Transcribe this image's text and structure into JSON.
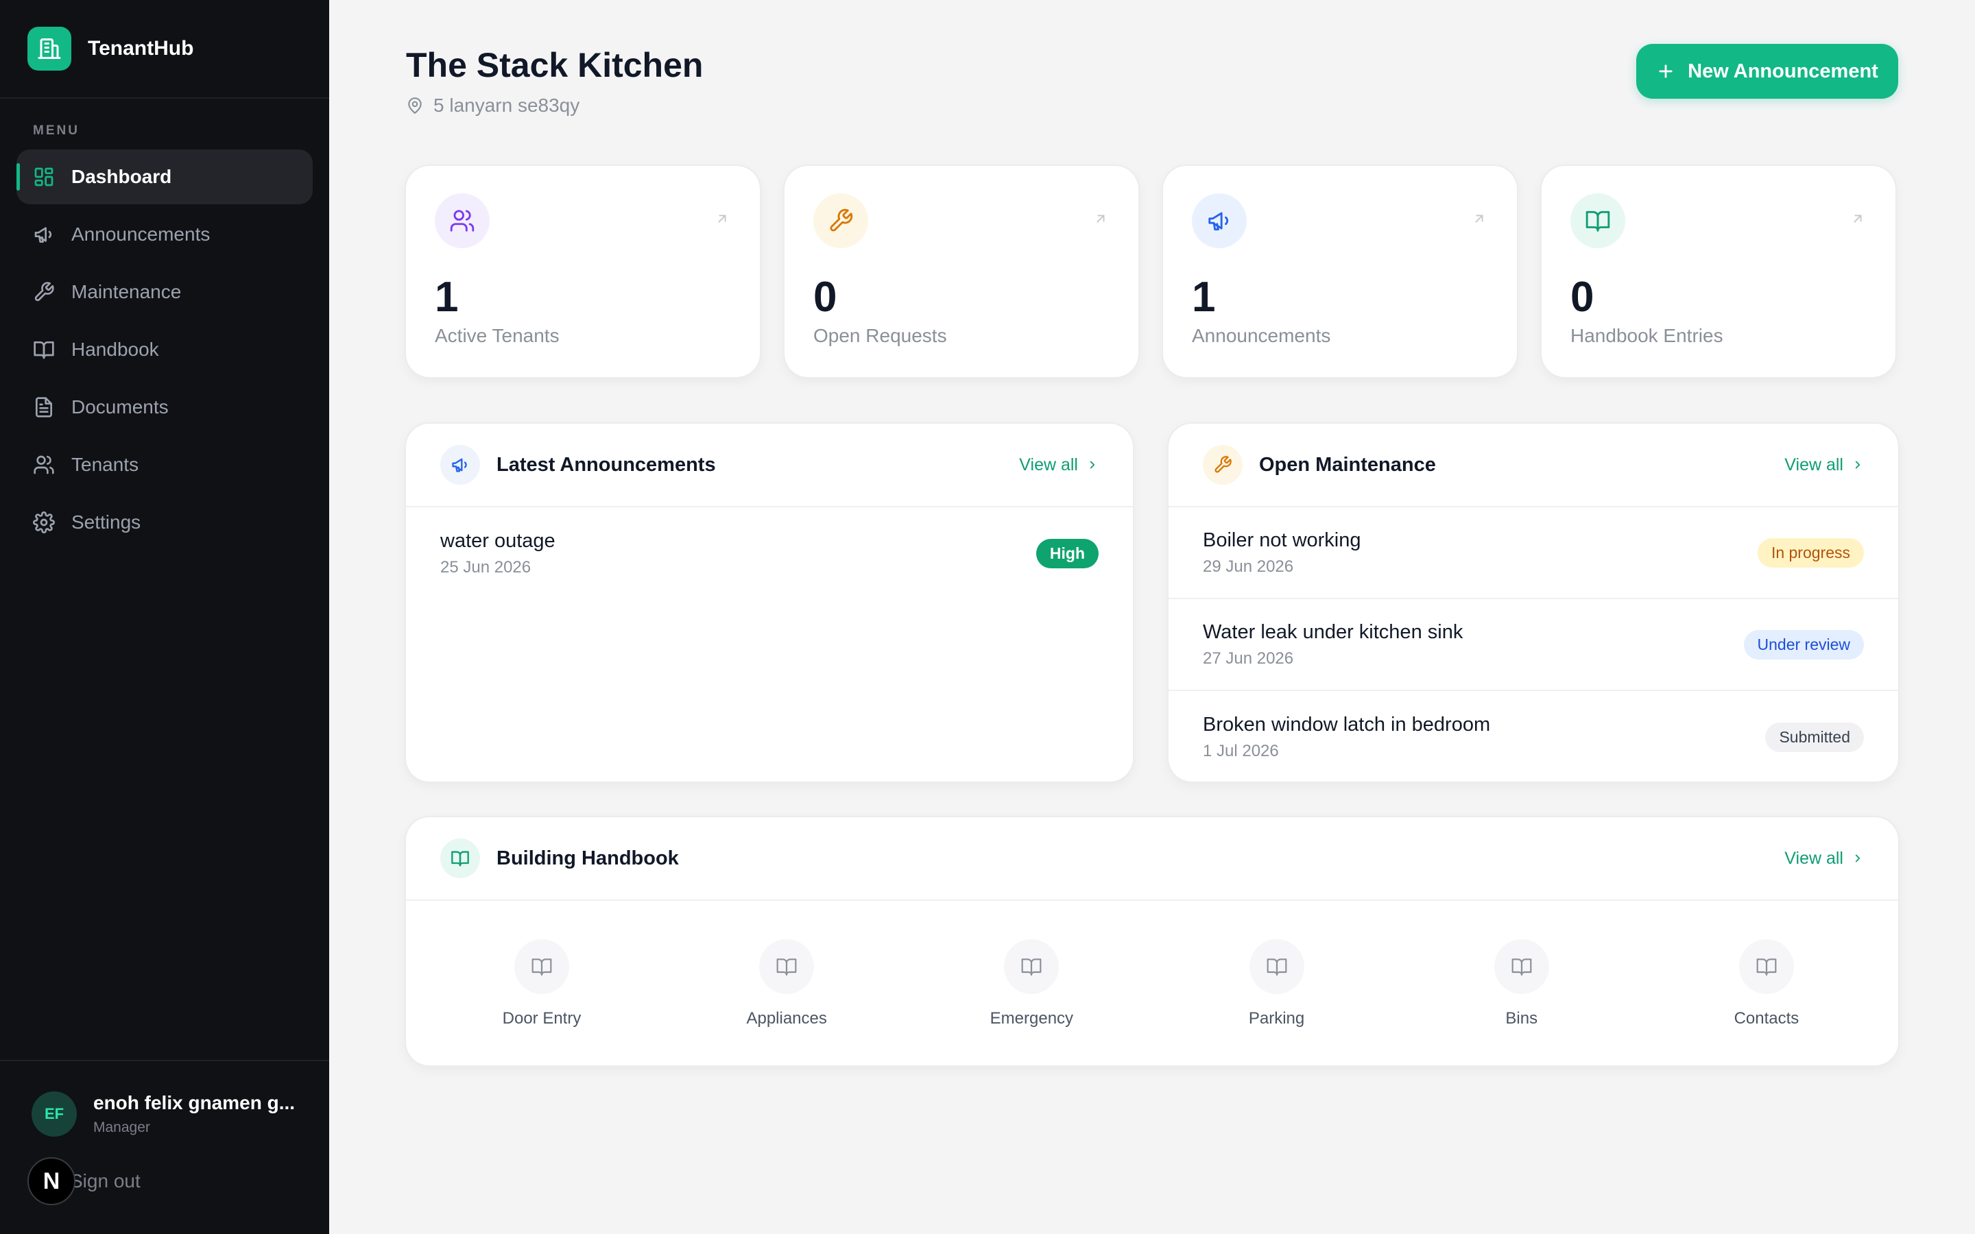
{
  "app": {
    "name": "TenantHub"
  },
  "sidebar": {
    "caption": "MENU",
    "items": [
      {
        "label": "Dashboard",
        "icon": "dashboard-icon",
        "active": true
      },
      {
        "label": "Announcements",
        "icon": "megaphone-icon"
      },
      {
        "label": "Maintenance",
        "icon": "wrench-icon"
      },
      {
        "label": "Handbook",
        "icon": "book-icon"
      },
      {
        "label": "Documents",
        "icon": "document-icon"
      },
      {
        "label": "Tenants",
        "icon": "users-icon"
      },
      {
        "label": "Settings",
        "icon": "gear-icon"
      }
    ],
    "user": {
      "initials": "EF",
      "name": "enoh felix gnamen g...",
      "role": "Manager"
    },
    "signout_label": "Sign out",
    "dev_badge": "N"
  },
  "header": {
    "title": "The Stack Kitchen",
    "address": "5 lanyarn se83qy",
    "new_button_label": "New Announcement"
  },
  "stats": [
    {
      "value": "1",
      "label": "Active Tenants",
      "icon": "users-icon",
      "color": "#7c3aed"
    },
    {
      "value": "0",
      "label": "Open Requests",
      "icon": "wrench-icon",
      "color": "#d97706"
    },
    {
      "value": "1",
      "label": "Announcements",
      "icon": "megaphone-icon",
      "color": "#2563eb"
    },
    {
      "value": "0",
      "label": "Handbook Entries",
      "icon": "book-icon",
      "color": "#0f9d73"
    }
  ],
  "announcements": {
    "title": "Latest Announcements",
    "view_all": "View all",
    "items": [
      {
        "title": "water outage",
        "date": "25 Jun 2026",
        "badge": "High"
      }
    ]
  },
  "maintenance": {
    "title": "Open Maintenance",
    "view_all": "View all",
    "items": [
      {
        "title": "Boiler not working",
        "date": "29 Jun 2026",
        "status": "In progress"
      },
      {
        "title": "Water leak under kitchen sink",
        "date": "27 Jun 2026",
        "status": "Under review"
      },
      {
        "title": "Broken window latch in bedroom",
        "date": "1 Jul 2026",
        "status": "Submitted"
      }
    ]
  },
  "handbook": {
    "title": "Building Handbook",
    "view_all": "View all",
    "items": [
      {
        "label": "Door Entry"
      },
      {
        "label": "Appliances"
      },
      {
        "label": "Emergency"
      },
      {
        "label": "Parking"
      },
      {
        "label": "Bins"
      },
      {
        "label": "Contacts"
      }
    ]
  }
}
